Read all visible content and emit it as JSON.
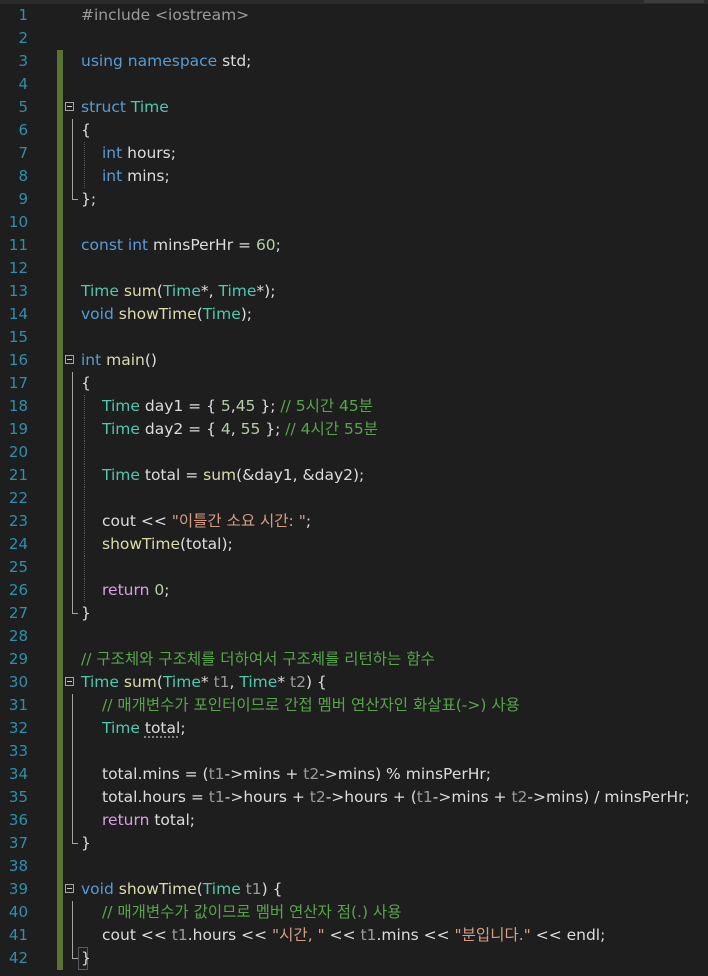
{
  "editor": {
    "line_numbers": [
      "1",
      "2",
      "3",
      "4",
      "5",
      "6",
      "7",
      "8",
      "9",
      "10",
      "11",
      "12",
      "13",
      "14",
      "15",
      "16",
      "17",
      "18",
      "19",
      "20",
      "21",
      "22",
      "23",
      "24",
      "25",
      "26",
      "27",
      "28",
      "29",
      "30",
      "31",
      "32",
      "33",
      "34",
      "35",
      "36",
      "37",
      "38",
      "39",
      "40",
      "41",
      "42"
    ],
    "code": {
      "l1": "#include <iostream>",
      "l3_kw": "using namespace",
      "l3_rest": " std;",
      "l5_kw": "struct",
      "l5_ty": " Time",
      "l6": "{",
      "l7_kw": "int",
      "l7_rest": " hours;",
      "l8_kw": "int",
      "l8_rest": " mins;",
      "l9": "};",
      "l11_kw": "const int",
      "l11_a": " minsPerHr = ",
      "l11_num": "60",
      "l11_b": ";",
      "l13_ty": "Time",
      "l13_fn": " sum",
      "l13_a": "(",
      "l13_ty2": "Time",
      "l13_b": "*, ",
      "l13_ty3": "Time",
      "l13_c": "*);",
      "l14_kw": "void",
      "l14_fn": " showTime",
      "l14_a": "(",
      "l14_ty": "Time",
      "l14_b": ");",
      "l16_kw": "int",
      "l16_fn": " main",
      "l16_a": "()",
      "l17": "{",
      "l18_ty": "Time",
      "l18_a": " day1 = { ",
      "l18_n1": "5",
      "l18_b": ",",
      "l18_n2": "45",
      "l18_c": " }; ",
      "l18_cmt": "// 5시간 45분",
      "l19_ty": "Time",
      "l19_a": " day2 = { ",
      "l19_n1": "4",
      "l19_b": ", ",
      "l19_n2": "55",
      "l19_c": " }; ",
      "l19_cmt": "// 4시간 55분",
      "l21_ty": "Time",
      "l21_a": " total = ",
      "l21_fn": "sum",
      "l21_b": "(&day1, &day2);",
      "l23_a": "cout << ",
      "l23_str": "\"이틀간 소요 시간: \"",
      "l23_b": ";",
      "l24_fn": "showTime",
      "l24_a": "(total);",
      "l26_ctl": "return",
      "l26_a": " ",
      "l26_num": "0",
      "l26_b": ";",
      "l27": "}",
      "l29_cmt": "// 구조체와 구조체를 더하여서 구조체를 리턴하는 함수",
      "l30_ty": "Time",
      "l30_fn": " sum",
      "l30_a": "(",
      "l30_ty2": "Time",
      "l30_b": "* ",
      "l30_p1": "t1",
      "l30_c": ", ",
      "l30_ty3": "Time",
      "l30_d": "* ",
      "l30_p2": "t2",
      "l30_e": ") {",
      "l31_cmt": "// 매개변수가 포인터이므로 간접 멤버 연산자인 화살표(->) 사용",
      "l32_ty": "Time",
      "l32_a": " ",
      "l32_sq": "total",
      "l32_b": ";",
      "l34_a": "total.mins = (",
      "l34_p1": "t1",
      "l34_b": "->mins + ",
      "l34_p2": "t2",
      "l34_c": "->mins) % minsPerHr;",
      "l35_a": "total.hours = ",
      "l35_p1": "t1",
      "l35_b": "->hours + ",
      "l35_p2": "t2",
      "l35_c": "->hours + (",
      "l35_p3": "t1",
      "l35_d": "->mins + ",
      "l35_p4": "t2",
      "l35_e": "->mins) / minsPerHr;",
      "l36_ctl": "return",
      "l36_a": " total;",
      "l37": "}",
      "l39_kw": "void",
      "l39_fn": " showTime",
      "l39_a": "(",
      "l39_ty": "Time",
      "l39_b": " ",
      "l39_p": "t1",
      "l39_c": ") {",
      "l40_cmt": "// 매개변수가 값이므로 멤버 연산자 점(.) 사용",
      "l41_a": "cout << ",
      "l41_p1": "t1",
      "l41_b": ".hours << ",
      "l41_s1": "\"시간, \"",
      "l41_c": " << ",
      "l41_p2": "t1",
      "l41_d": ".mins << ",
      "l41_s2": "\"분입니다.\"",
      "l41_e": " << endl;",
      "l42": "}"
    }
  },
  "colors": {
    "background": "#1e1e1e",
    "line_number": "#2b91af",
    "keyword": "#569cd6",
    "type": "#4ec9b0",
    "function": "#dcdcaa",
    "string": "#d69d85",
    "comment": "#57a64a",
    "number": "#b5cea8",
    "change_margin": "#577430"
  }
}
